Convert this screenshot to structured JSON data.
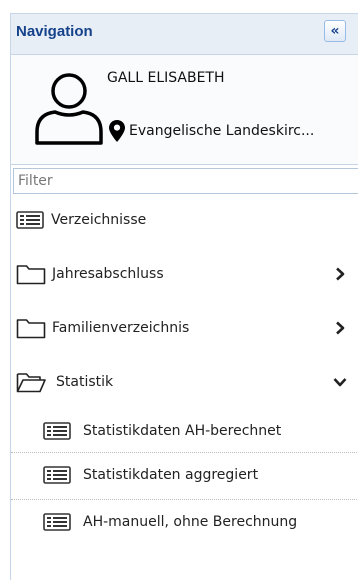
{
  "navigation": {
    "title": "Navigation",
    "collapse_glyph": "«",
    "collapse_icon": "double-chevron-left-icon"
  },
  "user": {
    "name": "GALL ELISABETH",
    "organization": "Evangelische Landeskirc..."
  },
  "filter": {
    "placeholder": "Filter",
    "value": ""
  },
  "menu": {
    "items": [
      {
        "label": "Verzeichnisse",
        "icon": "list-icon"
      },
      {
        "label": "Jahresabschluss",
        "icon": "folder-icon",
        "state": "collapsed"
      },
      {
        "label": "Familienverzeichnis",
        "icon": "folder-icon",
        "state": "collapsed"
      },
      {
        "label": "Statistik",
        "icon": "folder-open-icon",
        "state": "expanded"
      }
    ],
    "subitems": [
      {
        "label": "Statistikdaten AH-berechnet",
        "icon": "list-icon"
      },
      {
        "label": "Statistikdaten aggregiert",
        "icon": "list-icon"
      },
      {
        "label": "AH-manuell, ohne Berechnung",
        "icon": "list-icon"
      }
    ]
  },
  "colors": {
    "header_bg": "#e8eef6",
    "header_text": "#15428b",
    "border": "#c6d5e8"
  }
}
